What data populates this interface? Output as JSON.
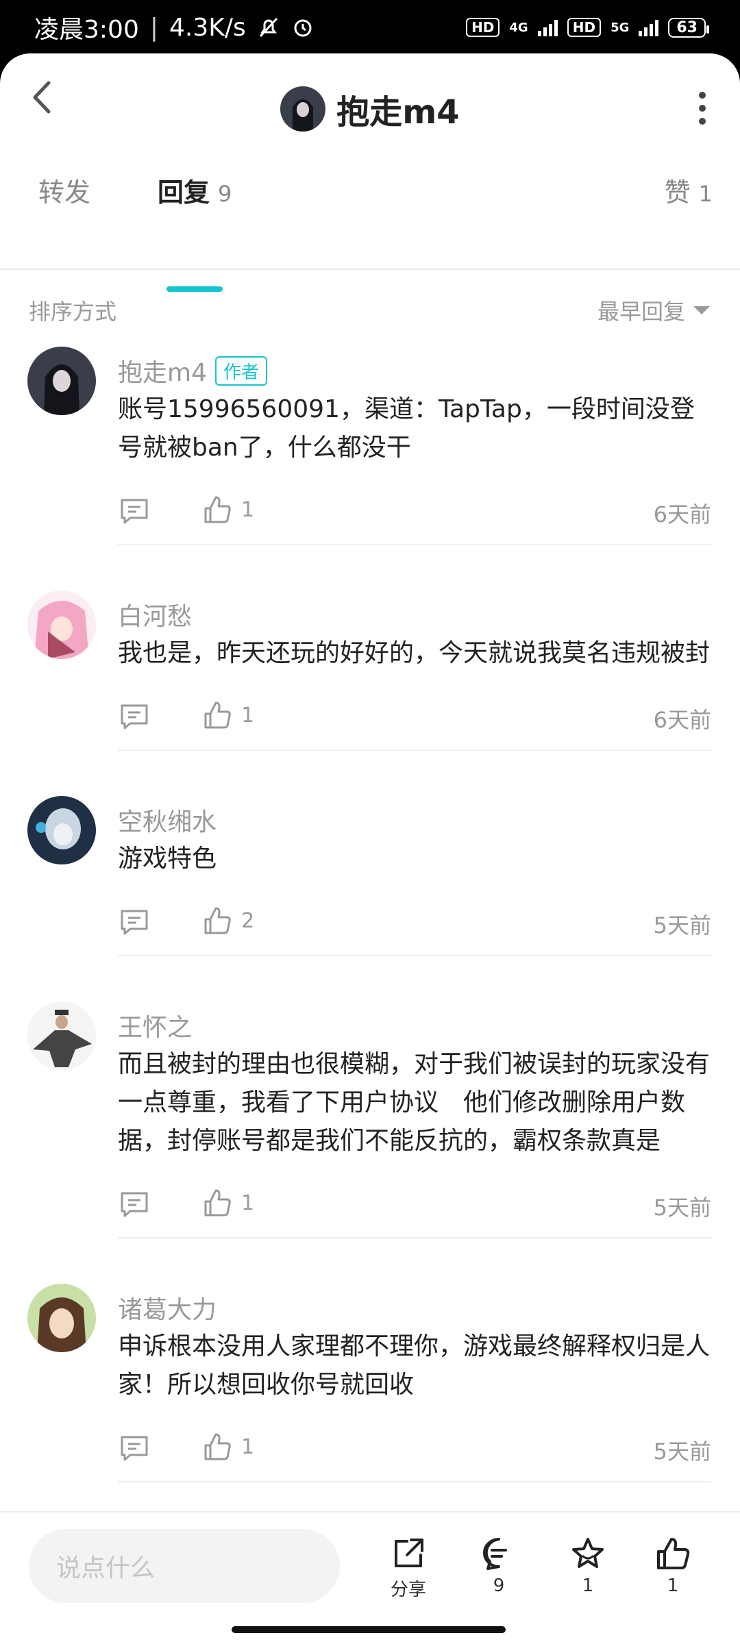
{
  "status_bar": {
    "time": "凌晨3:00",
    "speed": "4.3K/s",
    "hd1": "HD",
    "net1": "4G",
    "hd2": "HD",
    "net2": "5G",
    "battery": "63"
  },
  "header": {
    "title": "抱走m4",
    "avatar_icon": "user-avatar-icon"
  },
  "tabs": [
    {
      "label": "转发",
      "count": ""
    },
    {
      "label": "回复",
      "count": "9"
    },
    {
      "label": "赞",
      "count": "1"
    }
  ],
  "sort": {
    "label": "排序方式",
    "value": "最早回复"
  },
  "author_badge": "作者",
  "comments": [
    {
      "name": "抱走m4",
      "is_author": true,
      "content": "账号15996560091，渠道：TapTap，一段时间没登号就被ban了，什么都没干",
      "likes": "1",
      "time": "6天前",
      "avatar_color": "#3a3d4a"
    },
    {
      "name": "白河愁",
      "is_author": false,
      "content": "我也是，昨天还玩的好好的，今天就说我莫名违规被封",
      "likes": "1",
      "time": "6天前",
      "avatar_color": "#f4a7c5"
    },
    {
      "name": "空秋缃水",
      "is_author": false,
      "content": "游戏特色",
      "likes": "2",
      "time": "5天前",
      "avatar_color": "#2b3f57"
    },
    {
      "name": "王怀之",
      "is_author": false,
      "content": "而且被封的理由也很模糊，对于我们被误封的玩家没有一点尊重，我看了下用户协议　他们修改删除用户数据，封停账号都是我们不能反抗的，霸权条款真是",
      "likes": "1",
      "time": "5天前",
      "avatar_color": "#f2f2f2"
    },
    {
      "name": "诸葛大力",
      "is_author": false,
      "content": "申诉根本没用人家理都不理你，游戏最终解释权归是人家！所以想回收你号就回收",
      "likes": "1",
      "time": "5天前",
      "avatar_color": "#c9a58c"
    }
  ],
  "bottom_bar": {
    "input_placeholder": "说点什么",
    "share_label": "分享",
    "comment_count": "9",
    "fav_count": "1",
    "like_count": "1"
  },
  "colors": {
    "accent": "#15c5ce",
    "muted_text": "#999999",
    "body_text": "#222222"
  }
}
